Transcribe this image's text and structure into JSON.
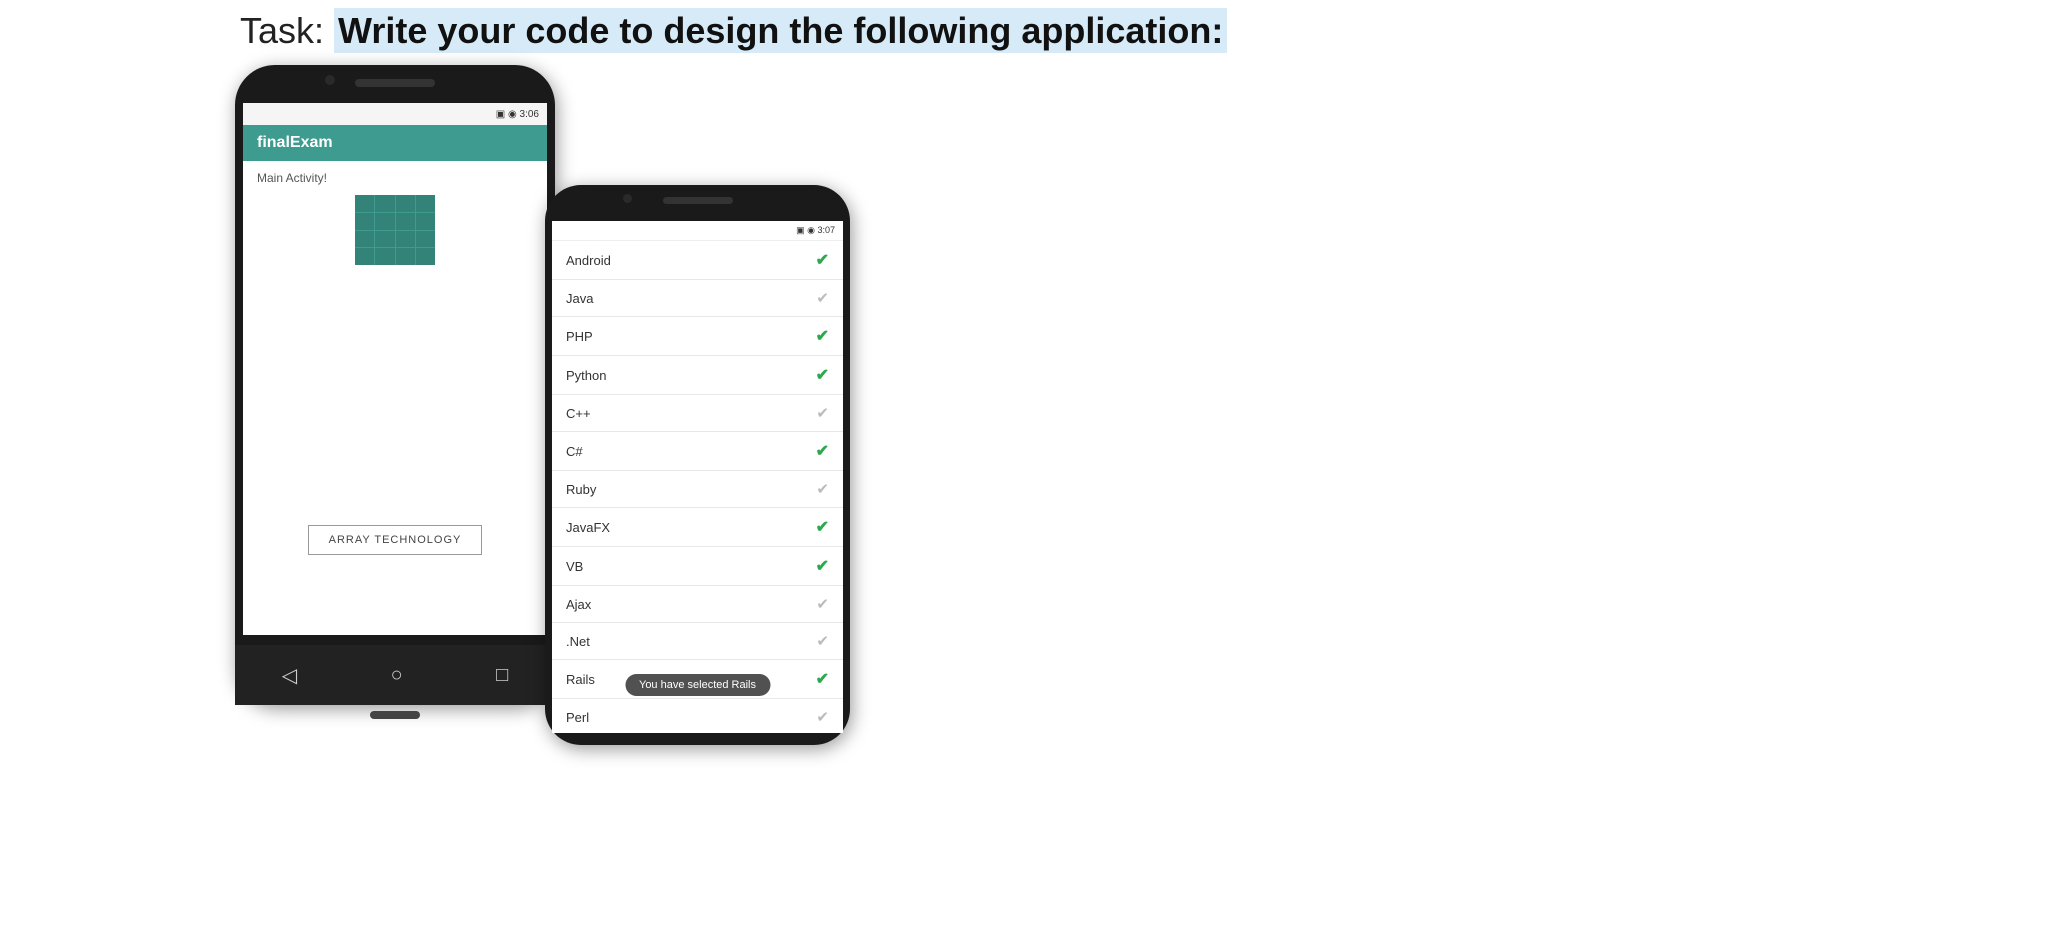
{
  "title": {
    "prefix": "Task: ",
    "highlight": "Write your code to design the following application:"
  },
  "phone1": {
    "statusbar": "▣ ◉ 3:06",
    "toolbar_title": "finalExam",
    "main_activity": "Main Activity!",
    "array_button": "ARRAY TECHNOLOGY"
  },
  "phone2": {
    "statusbar": "▣ ◉ 3:07",
    "items": [
      {
        "label": "Android",
        "checked": true
      },
      {
        "label": "Java",
        "checked": false
      },
      {
        "label": "PHP",
        "checked": true
      },
      {
        "label": "Python",
        "checked": true
      },
      {
        "label": "C++",
        "checked": false
      },
      {
        "label": "C#",
        "checked": true
      },
      {
        "label": "Ruby",
        "checked": false
      },
      {
        "label": "JavaFX",
        "checked": true
      },
      {
        "label": "VB",
        "checked": true
      },
      {
        "label": "Ajax",
        "checked": false
      },
      {
        "label": ".Net",
        "checked": false
      },
      {
        "label": "Rails",
        "checked": true
      },
      {
        "label": "Perl",
        "checked": false
      }
    ],
    "toast": "You have selected Rails"
  }
}
